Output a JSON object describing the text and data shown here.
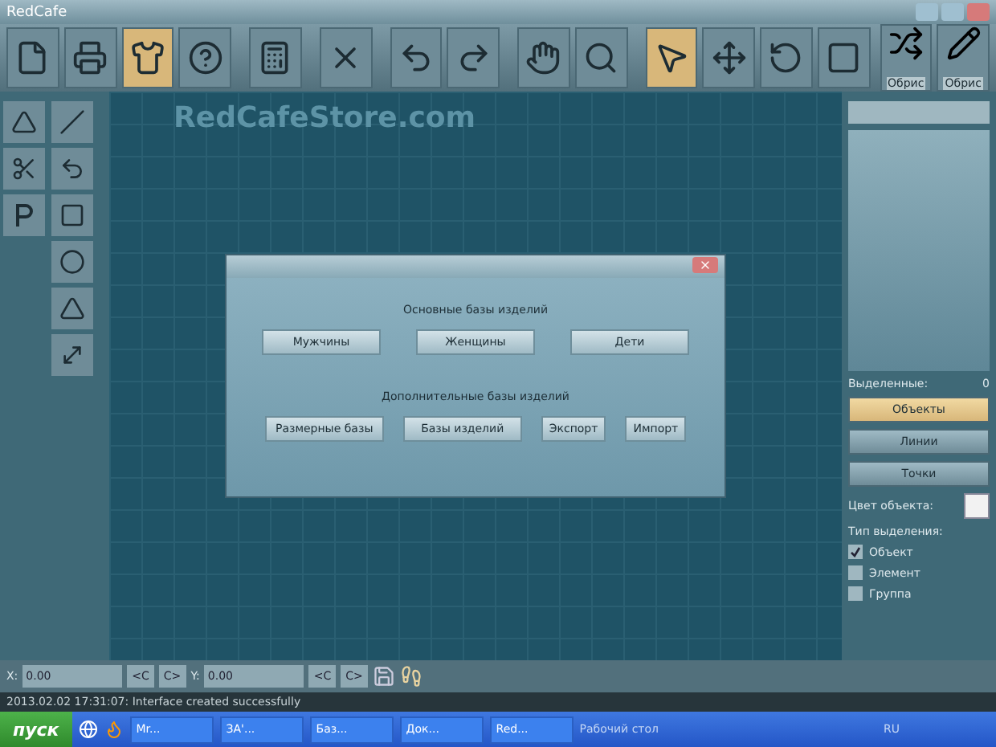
{
  "window": {
    "title": "RedCafe"
  },
  "toolbar": [
    {
      "selected": false
    },
    {
      "selected": false
    },
    {
      "selected": true
    },
    {
      "selected": false
    },
    {
      "selected": false
    },
    {
      "selected": false
    },
    {
      "selected": false
    },
    {
      "selected": false
    },
    {
      "selected": false
    },
    {
      "selected": false
    },
    {
      "selected": true
    },
    {
      "selected": false
    },
    {
      "selected": false
    },
    {
      "selected": false
    }
  ],
  "toolbar_labeled": [
    {
      "label": "Обрис"
    },
    {
      "label": "Обрис"
    }
  ],
  "canvas": {
    "brand": "RedCafeStore.com"
  },
  "dialog": {
    "section_1": "Основные базы изделий",
    "buttons_1": [
      "Мужчины",
      "Женщины",
      "Дети"
    ],
    "section_2": "Дополнительные базы изделий",
    "buttons_2": [
      "Размерные базы",
      "Базы изделий",
      "Экспорт",
      "Импорт"
    ]
  },
  "right_panel": {
    "selected_label": "Выделенные:",
    "selected_count": "0",
    "modes": [
      {
        "label": "Объекты",
        "selected": true
      },
      {
        "label": "Линии",
        "selected": false
      },
      {
        "label": "Точки",
        "selected": false
      }
    ],
    "color_label": "Цвет объекта:",
    "type_label": "Тип выделения:",
    "types": [
      {
        "label": "Объект",
        "checked": true
      },
      {
        "label": "Элемент",
        "checked": false
      },
      {
        "label": "Группа",
        "checked": false
      }
    ]
  },
  "coords": [
    {
      "axis": "X:",
      "value": "0.00",
      "prev": "<C",
      "next": "C>"
    },
    {
      "axis": "Y:",
      "value": "0.00",
      "prev": "<C",
      "next": "C>"
    }
  ],
  "status_bar": "2013.02.02 17:31:07: Interface created successfully",
  "taskbar": {
    "start": "пуск",
    "tasks": [
      "Mr...",
      "ЗА'...",
      "Баз...",
      "Док...",
      "Red..."
    ],
    "desktop": "Рабочий стол",
    "lang": "RU"
  }
}
